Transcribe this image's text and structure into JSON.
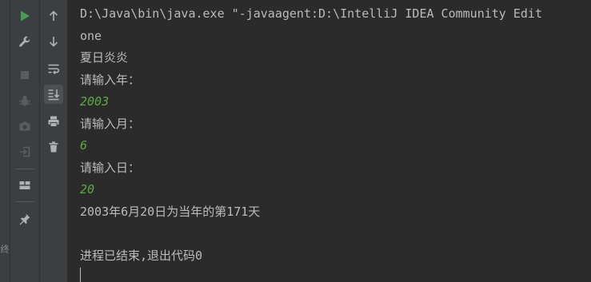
{
  "side_panel": {
    "edge_label": "终"
  },
  "toolbar_left": {
    "icons": [
      "run-icon",
      "wrench-icon",
      "stop-icon",
      "debug-icon",
      "camera-icon",
      "exit-icon",
      "layout-icon",
      "pin-icon"
    ]
  },
  "toolbar_right": {
    "icons": [
      "up-arrow-icon",
      "down-arrow-icon",
      "soft-wrap-icon",
      "scroll-to-end-icon",
      "print-icon",
      "trash-icon"
    ]
  },
  "console": {
    "command_line": "D:\\Java\\bin\\java.exe \"-javaagent:D:\\IntelliJ IDEA Community Edit",
    "lines": [
      {
        "text": "one",
        "type": "output"
      },
      {
        "text": "夏日炎炎",
        "type": "output"
      },
      {
        "text": "请输入年：",
        "type": "output"
      },
      {
        "text": "2003",
        "type": "input"
      },
      {
        "text": "请输入月：",
        "type": "output"
      },
      {
        "text": "6",
        "type": "input"
      },
      {
        "text": "请输入日：",
        "type": "output"
      },
      {
        "text": "20",
        "type": "input"
      },
      {
        "text": "2003年6月20日为当年的第171天",
        "type": "output"
      },
      {
        "text": "",
        "type": "output"
      },
      {
        "text": "进程已结束,退出代码0",
        "type": "output"
      }
    ]
  },
  "colors": {
    "background": "#2b2b2b",
    "toolbar": "#3c3f41",
    "text": "#bbbbbb",
    "user_input": "#5ca942",
    "run_green": "#499c54"
  }
}
